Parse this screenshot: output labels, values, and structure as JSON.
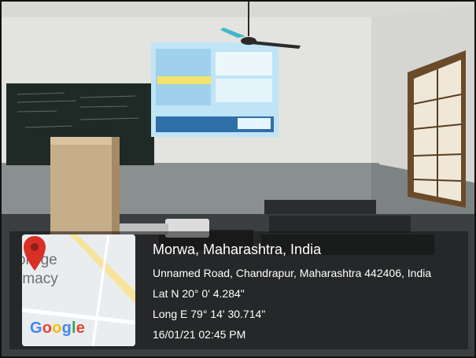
{
  "photo": {
    "scene": "classroom-with-projector",
    "colors": {
      "wall": "#e6e6e3",
      "chalkboard": "#1f2a26",
      "screen": "#bfe4f6",
      "floor": "#3b3f41"
    }
  },
  "map": {
    "labels": [
      "ollege",
      "rmacy"
    ],
    "logo_text": "Google",
    "pin_color": "#d93025"
  },
  "geotag": {
    "place": "Morwa, Maharashtra, India",
    "address": "Unnamed Road, Chandrapur, Maharashtra 442406, India",
    "lat": "Lat N 20° 0' 4.284\"",
    "long": "Long E 79° 14' 30.714\"",
    "datetime": "16/01/21 02:45 PM"
  }
}
